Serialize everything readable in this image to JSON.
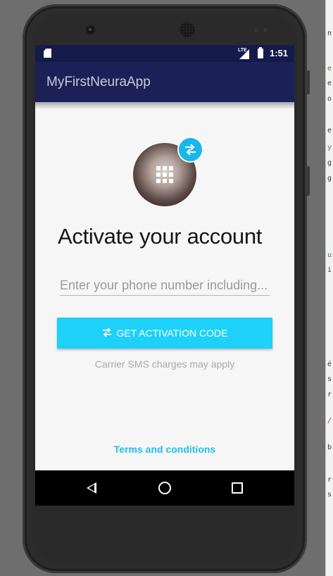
{
  "status_bar": {
    "network": "LTE",
    "time": "1:51"
  },
  "app_bar": {
    "title": "MyFirstNeuraApp"
  },
  "activation": {
    "headline": "Activate your account",
    "phone_placeholder": "Enter your phone number including...",
    "phone_value": "",
    "button_label": "GET ACTIVATION CODE",
    "sms_note": "Carrier SMS charges may apply",
    "terms_link": "Terms and conditions"
  },
  "colors": {
    "app_bar": "#1b2057",
    "status_bar": "#141a4a",
    "accent": "#1dd1f8",
    "link": "#1cc2ec"
  },
  "icons": {
    "avatar": "dialpad-icon",
    "badge": "swap-arrows-icon",
    "button": "swap-arrows-icon",
    "nav": [
      "back-icon",
      "home-icon",
      "recents-icon"
    ]
  }
}
